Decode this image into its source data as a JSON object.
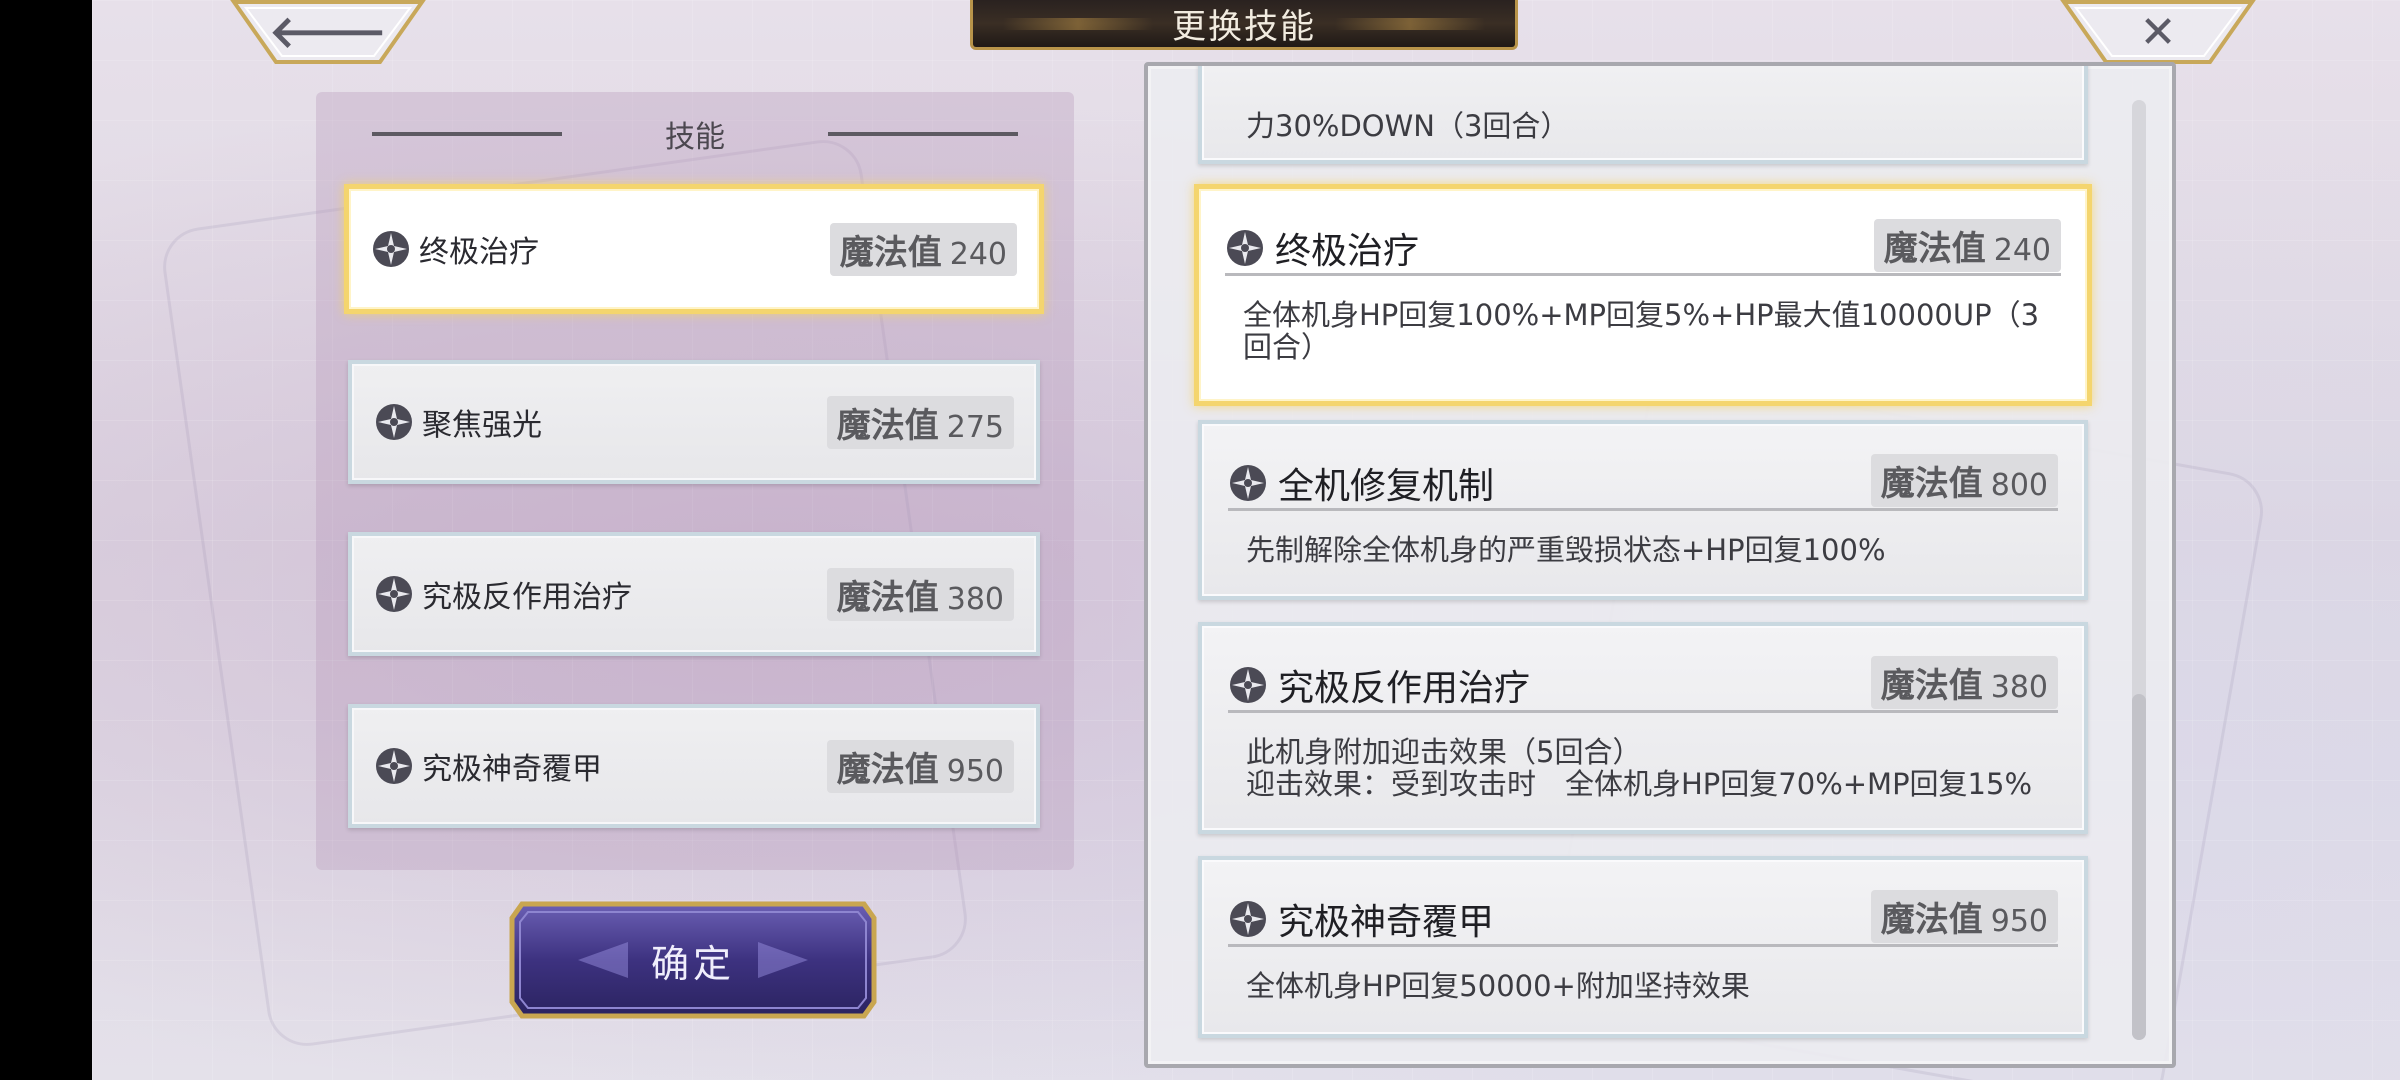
{
  "title": "更换技能",
  "nav": {
    "back_icon": "arrow-left-icon",
    "close_icon": "close-x-icon",
    "back_glyph": "🡐",
    "close_glyph": "✕"
  },
  "left_panel": {
    "header": "技能",
    "slots": [
      {
        "name": "终极治疗",
        "mp_label": "魔法值",
        "mp": "240",
        "selected": true
      },
      {
        "name": "聚焦强光",
        "mp_label": "魔法值",
        "mp": "275",
        "selected": false
      },
      {
        "name": "究极反作用治疗",
        "mp_label": "魔法值",
        "mp": "380",
        "selected": false
      },
      {
        "name": "究极神奇覆甲",
        "mp_label": "魔法值",
        "mp": "950",
        "selected": false
      }
    ],
    "confirm_label": "确定"
  },
  "right_panel": {
    "partial_card": {
      "desc": "力30%DOWN（3回合）"
    },
    "cards": [
      {
        "name": "终极治疗",
        "mp_label": "魔法值",
        "mp": "240",
        "selected": true,
        "desc": "全体机身HP回复100%+MP回复5%+HP最大值10000UP（3\n回合）"
      },
      {
        "name": "全机修复机制",
        "mp_label": "魔法值",
        "mp": "800",
        "selected": false,
        "desc": "先制解除全体机身的严重毁损状态+HP回复100%"
      },
      {
        "name": "究极反作用治疗",
        "mp_label": "魔法值",
        "mp": "380",
        "selected": false,
        "desc": "此机身附加迎击效果（5回合）\n迎击效果：受到攻击时　全体机身HP回复70%+MP回复15%"
      },
      {
        "name": "究极神奇覆甲",
        "mp_label": "魔法值",
        "mp": "950",
        "selected": false,
        "desc": "全体机身HP回复50000+附加坚持效果"
      }
    ]
  },
  "colors": {
    "selected_border": "#f4d56e",
    "card_border": "#c9d8e0",
    "title_gold": "#b8944a",
    "confirm_purple": "#4a3d8f"
  }
}
